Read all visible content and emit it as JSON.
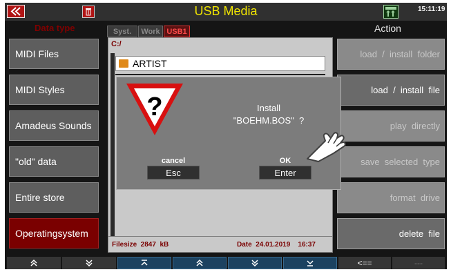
{
  "title": "USB Media",
  "clock": "15:11:19",
  "headers": {
    "data_type": "Data type",
    "action": "Action"
  },
  "data_types": [
    {
      "label": "MIDI Files"
    },
    {
      "label": "MIDI Styles"
    },
    {
      "label": "Amadeus Sounds"
    },
    {
      "label": "\"old\" data"
    },
    {
      "label": "Entire store"
    },
    {
      "label": "Operatingsystem",
      "selected": true
    }
  ],
  "actions": [
    {
      "label": "load  /  install  folder",
      "enabled": false
    },
    {
      "label": "load  /  install  file",
      "enabled": true
    },
    {
      "label": "play  directly",
      "enabled": false
    },
    {
      "label": "save  selected  type",
      "enabled": false
    },
    {
      "label": "format  drive",
      "enabled": false
    },
    {
      "label": "delete  file",
      "enabled": true
    }
  ],
  "tabs": [
    {
      "label": "Syst."
    },
    {
      "label": "Work"
    },
    {
      "label": "USB1",
      "active": true
    }
  ],
  "browser": {
    "path": "C:/",
    "folder": "ARTIST",
    "filesize": "Filesize  2847  kB",
    "date": "Date  24.01.2019    16:37"
  },
  "dialog": {
    "line1": "Install",
    "line2": "\"BOEHM.BOS\"  ?",
    "cancel_label": "cancel",
    "cancel_button": "Esc",
    "ok_label": "OK",
    "ok_button": "Enter"
  },
  "bottom_bar": {
    "page_left": "<==",
    "page_right": "---"
  },
  "colors": {
    "title": "#f2e600",
    "selected_type": "#7a0000",
    "active_tab": "#e03030",
    "nav_blue": "#1c4260"
  },
  "icons": [
    "back-icon",
    "trash-icon",
    "usb-icon",
    "warning-question-icon",
    "pointing-hand-icon",
    "double-up-icon",
    "double-down-icon",
    "top-icon",
    "up-icon",
    "down-icon",
    "bottom-icon"
  ]
}
